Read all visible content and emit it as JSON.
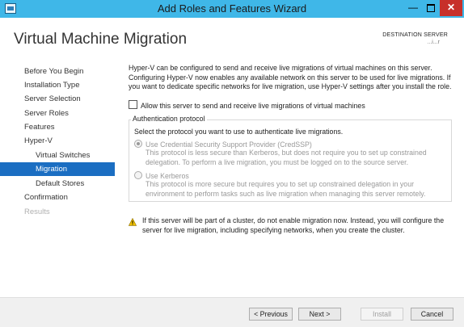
{
  "window": {
    "title": "Add Roles and Features Wizard",
    "minimize_glyph": "—",
    "close_glyph": "✕"
  },
  "header": {
    "page_title": "Virtual Machine Migration",
    "destination_label": "DESTINATION SERVER",
    "destination_name": "...i...r"
  },
  "nav": {
    "items": [
      {
        "label": "Before You Begin",
        "state": "normal",
        "indent": false
      },
      {
        "label": "Installation Type",
        "state": "normal",
        "indent": false
      },
      {
        "label": "Server Selection",
        "state": "normal",
        "indent": false
      },
      {
        "label": "Server Roles",
        "state": "normal",
        "indent": false
      },
      {
        "label": "Features",
        "state": "normal",
        "indent": false
      },
      {
        "label": "Hyper-V",
        "state": "normal",
        "indent": false
      },
      {
        "label": "Virtual Switches",
        "state": "normal",
        "indent": true
      },
      {
        "label": "Migration",
        "state": "active",
        "indent": true
      },
      {
        "label": "Default Stores",
        "state": "normal",
        "indent": true
      },
      {
        "label": "Confirmation",
        "state": "normal",
        "indent": false
      },
      {
        "label": "Results",
        "state": "disabled",
        "indent": false
      }
    ]
  },
  "main": {
    "description": "Hyper-V can be configured to send and receive live migrations of virtual machines on this server. Configuring Hyper-V now enables any available network on this server to be used for live migrations. If you want to dedicate specific networks for live migration, use Hyper-V settings after you install the role.",
    "allow_checkbox": {
      "label": "Allow this server to send and receive live migrations of virtual machines",
      "checked": false
    },
    "auth_group": {
      "legend": "Authentication protocol",
      "intro": "Select the protocol you want to use to authenticate live migrations.",
      "options": [
        {
          "label": "Use Credential Security Support Provider (CredSSP)",
          "checked": true,
          "description": "This protocol is less secure than Kerberos, but does not require you to set up constrained delegation. To perform a live migration, you must be logged on to the source server."
        },
        {
          "label": "Use Kerberos",
          "checked": false,
          "description": "This protocol is more secure but requires you to set up constrained delegation in your environment to perform tasks such as live migration when managing this server remotely."
        }
      ]
    },
    "warning": "If this server will be part of a cluster, do not enable migration now. Instead, you will configure the server for live migration, including specifying networks, when you create the cluster."
  },
  "footer": {
    "previous_label": "< Previous",
    "next_label": "Next >",
    "install_label": "Install",
    "cancel_label": "Cancel"
  },
  "colors": {
    "titlebar": "#3fb7e8",
    "nav_active": "#1b6ec2",
    "close_button": "#c7302a"
  }
}
